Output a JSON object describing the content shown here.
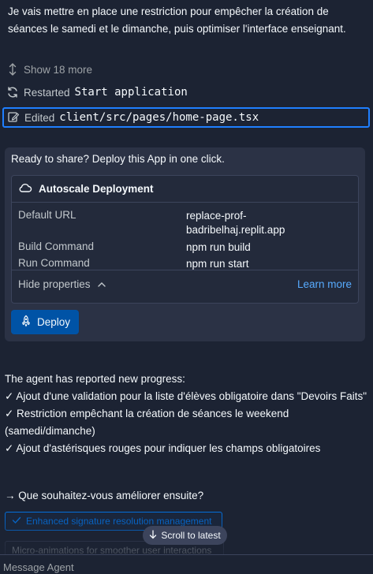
{
  "intro_text": "Je vais mettre en place une restriction pour empêcher la création de séances le samedi et le dimanche, puis optimiser l'interface enseignant.",
  "show_more": "Show 18 more",
  "restarted": {
    "label": "Restarted",
    "name": "Start application"
  },
  "edited": {
    "label": "Edited",
    "path": "client/src/pages/home-page.tsx"
  },
  "deploy_card": {
    "lead": "Ready to share? Deploy this App in one click.",
    "title": "Autoscale Deployment",
    "properties": [
      {
        "key": "Default URL",
        "value": "replace-prof-badribelhaj.replit.app"
      },
      {
        "key": "Build Command",
        "value": "npm run build"
      },
      {
        "key": "Run Command",
        "value": "npm run start"
      }
    ],
    "hide_properties": "Hide properties",
    "learn_more": "Learn more",
    "deploy_button": "Deploy"
  },
  "progress": {
    "heading": "The agent has reported new progress:",
    "items": [
      "✓ Ajout d'une validation pour la liste d'élèves obligatoire dans \"Devoirs Faits\"",
      "✓ Restriction empêchant la création de séances le weekend (samedi/dimanche)",
      "✓ Ajout d'astérisques rouges pour indiquer les champs obligatoires"
    ]
  },
  "question": "→ Que souhaitez-vous améliorer ensuite?",
  "suggestions": [
    "Enhanced signature resolution management",
    "Micro-animations for smoother user interactions"
  ],
  "scroll_to_latest": "Scroll to latest",
  "message_placeholder": "Message Agent",
  "icons": {
    "show_more": "expand-vertical-icon",
    "restarted": "restart-icon",
    "edited": "edit-file-icon",
    "deployment": "cloud-icon",
    "hide": "chevron-up-icon",
    "deploy": "rocket-icon",
    "suggestion": "check-icon",
    "scroll": "arrow-down-icon"
  },
  "colors": {
    "background": "#1c2333",
    "accent": "#1f7fff",
    "link": "#57abff",
    "button": "#0053a6"
  }
}
